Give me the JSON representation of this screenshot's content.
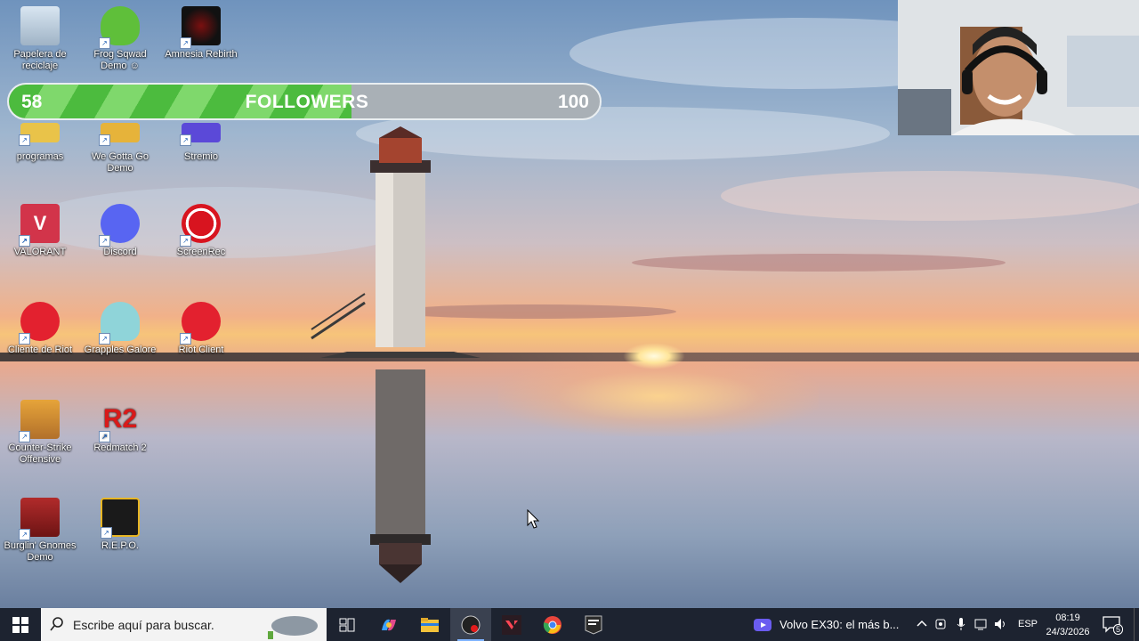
{
  "desktop": {
    "icons": [
      {
        "label": "Papelera de reciclaje",
        "icon": "recycle-bin-icon"
      },
      {
        "label": "Frog Sqwad Demo ☺",
        "icon": "frog-icon"
      },
      {
        "label": "Amnesia Rebirth",
        "icon": "amnesia-icon"
      },
      {
        "label": "programas",
        "icon": "folder-icon"
      },
      {
        "label": "We Gotta Go Demo",
        "icon": "we-gotta-go-icon"
      },
      {
        "label": "Stremio",
        "icon": "stremio-icon"
      },
      {
        "label": "VALORANT",
        "icon": "valorant-icon"
      },
      {
        "label": "Discord",
        "icon": "discord-icon"
      },
      {
        "label": "ScreenRec",
        "icon": "screenrec-icon"
      },
      {
        "label": "Cliente de Riot",
        "icon": "riot-icon"
      },
      {
        "label": "Grapples Galore",
        "icon": "grapples-icon"
      },
      {
        "label": "Riot Client",
        "icon": "riot-icon"
      },
      {
        "label": "Counter-Strike Offensive",
        "icon": "counter-strike-icon"
      },
      {
        "label": "Redmatch 2",
        "icon": "redmatch-icon"
      },
      {
        "label": "Burglin' Gnomes Demo",
        "icon": "gnome-icon"
      },
      {
        "label": "R.E.P.O.",
        "icon": "repo-icon"
      }
    ]
  },
  "followers": {
    "current": "58",
    "title": "FOLLOWERS",
    "goal": "100",
    "progress_fraction": 0.58
  },
  "taskbar": {
    "search_placeholder": "Escribe aquí para buscar.",
    "apps": [
      "task-view-icon",
      "copilot-icon",
      "file-explorer-icon",
      "obs-icon",
      "valorant-icon",
      "chrome-icon",
      "epic-games-icon"
    ],
    "media_title": "Volvo EX30: el más b...",
    "language": "ESP",
    "time": "08:19",
    "date": "24/3/2026",
    "notification_count": "5"
  },
  "colors": {
    "progress_green": "#4cbb3e",
    "taskbar_bg": "#1d2330"
  }
}
